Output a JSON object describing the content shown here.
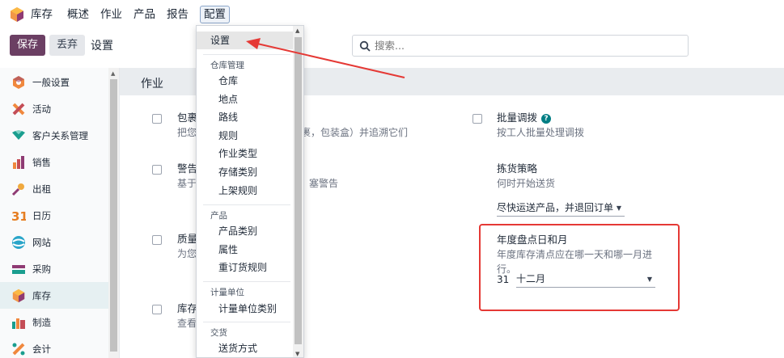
{
  "nav": {
    "app": "库存",
    "items": [
      "概述",
      "作业",
      "产品",
      "报告",
      "配置"
    ]
  },
  "control": {
    "save": "保存",
    "discard": "丢弃",
    "title": "设置",
    "search_placeholder": "搜索..."
  },
  "sidebar": {
    "items": [
      {
        "label": "一般设置",
        "icon": "settings-icon"
      },
      {
        "label": "活动",
        "icon": "activity-icon"
      },
      {
        "label": "客户关系管理",
        "icon": "crm-icon"
      },
      {
        "label": "销售",
        "icon": "sales-icon"
      },
      {
        "label": "出租",
        "icon": "rental-icon"
      },
      {
        "label": "日历",
        "icon": "calendar-icon"
      },
      {
        "label": "网站",
        "icon": "website-icon"
      },
      {
        "label": "采购",
        "icon": "purchase-icon"
      },
      {
        "label": "库存",
        "icon": "inventory-icon"
      },
      {
        "label": "制造",
        "icon": "manufacturing-icon"
      },
      {
        "label": "会计",
        "icon": "accounting-icon"
      }
    ],
    "calendar_number": "31"
  },
  "section": {
    "title": "作业"
  },
  "settings": {
    "packages": {
      "title": "包裹",
      "desc_prefix": "把您",
      "desc_suffix": "裹，包装盒）并追溯它们"
    },
    "warnings": {
      "title": "警告",
      "desc_prefix": "基于",
      "desc_suffix": "塞警告"
    },
    "quality": {
      "title": "质量",
      "desc_prefix": "为您"
    },
    "stock": {
      "title": "库存",
      "desc_prefix": "查看"
    },
    "batch": {
      "title": "批量调拨",
      "desc": "按工人批量处理调拨",
      "help": "?"
    },
    "picking": {
      "title": "拣货策略",
      "desc": "何时开始送货",
      "value": "尽快运送产品，并退回订单"
    },
    "annual": {
      "title": "年度盘点日和月",
      "desc": "年度库存清点应在哪一天和哪一月进行。",
      "day": "31",
      "month": "十二月"
    }
  },
  "dropdown": {
    "first": "设置",
    "group1": {
      "header": "仓库管理",
      "items": [
        "仓库",
        "地点",
        "路线",
        "规则",
        "作业类型",
        "存储类别",
        "上架规则"
      ]
    },
    "group2": {
      "header": "产品",
      "items": [
        "产品类别",
        "属性",
        "重订货规则"
      ]
    },
    "group3": {
      "header": "计量单位",
      "items": [
        "计量单位类别"
      ]
    },
    "group4": {
      "header": "交货",
      "items": [
        "送货方式"
      ]
    }
  },
  "colors": {
    "brand": "#6b3f63",
    "accent": "#017e84",
    "annotation": "#e53935"
  }
}
